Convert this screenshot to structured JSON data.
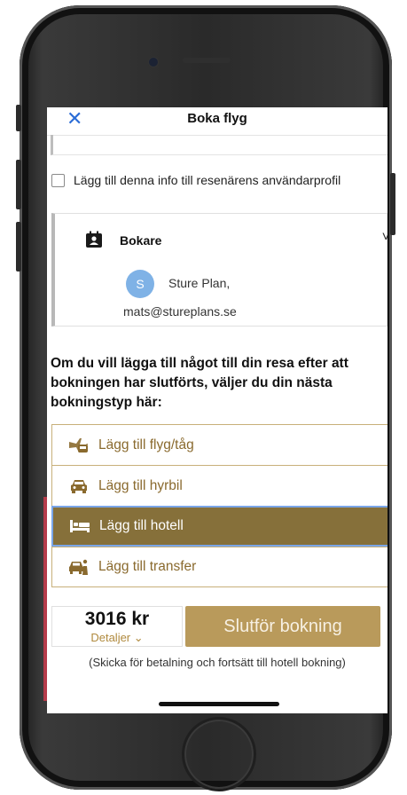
{
  "header": {
    "close_icon": "close-icon",
    "title": "Boka flyg"
  },
  "profile_checkbox": {
    "label": "Lägg till denna info till resenärens användarprofil",
    "checked": false
  },
  "booker": {
    "icon": "contact-card-icon",
    "title": "Bokare",
    "avatar_initial": "S",
    "name": "Sture Plan,",
    "email": "mats@stureplans.se"
  },
  "info_text": "Om du vill lägga till något till din resa efter att bokningen har slutförts, väljer du din nästa bokningstyp här:",
  "options": [
    {
      "label": "Lägg till flyg/tåg",
      "icon": "plane-train-icon",
      "selected": false
    },
    {
      "label": "Lägg till hyrbil",
      "icon": "car-icon",
      "selected": false
    },
    {
      "label": "Lägg till hotell",
      "icon": "bed-icon",
      "selected": true
    },
    {
      "label": "Lägg till transfer",
      "icon": "transfer-icon",
      "selected": false
    }
  ],
  "summary": {
    "price": "3016 kr",
    "details_label": "Detaljer ⌄",
    "submit_label": "Slutför bokning"
  },
  "hint": "(Skicka för betalning och fortsätt till hotell bokning)",
  "colors": {
    "accent_gold": "#b99a5b",
    "selected_bg": "#86703a",
    "link_blue": "#2b6cd6"
  }
}
